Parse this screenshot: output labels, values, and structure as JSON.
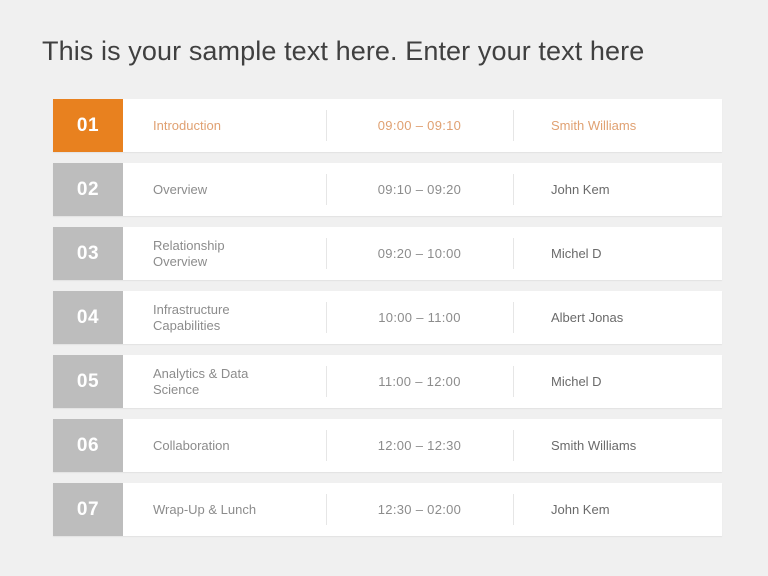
{
  "slide": {
    "title": "This is your sample text here. Enter your text here",
    "background_color": "#f0f0f0",
    "accent_color": "#e8811f",
    "muted_color": "#bdbdbd"
  },
  "agenda": {
    "rows": [
      {
        "number": "01",
        "topic_line1": "Introduction",
        "topic_line2": "",
        "time": "09:00 – 09:10",
        "speaker": "Smith Williams",
        "active": true
      },
      {
        "number": "02",
        "topic_line1": "Overview",
        "topic_line2": "",
        "time": "09:10 – 09:20",
        "speaker": "John Kem",
        "active": false
      },
      {
        "number": "03",
        "topic_line1": "Relationship",
        "topic_line2": "Overview",
        "time": "09:20 – 10:00",
        "speaker": "Michel D",
        "active": false
      },
      {
        "number": "04",
        "topic_line1": "Infrastructure",
        "topic_line2": "Capabilities",
        "time": "10:00 – 11:00",
        "speaker": "Albert Jonas",
        "active": false
      },
      {
        "number": "05",
        "topic_line1": "Analytics & Data",
        "topic_line2": "Science",
        "time": "11:00 – 12:00",
        "speaker": "Michel D",
        "active": false
      },
      {
        "number": "06",
        "topic_line1": "Collaboration",
        "topic_line2": "",
        "time": "12:00 – 12:30",
        "speaker": "Smith Williams",
        "active": false
      },
      {
        "number": "07",
        "topic_line1": "Wrap-Up & Lunch",
        "topic_line2": "",
        "time": "12:30 – 02:00",
        "speaker": "John Kem",
        "active": false
      }
    ]
  }
}
